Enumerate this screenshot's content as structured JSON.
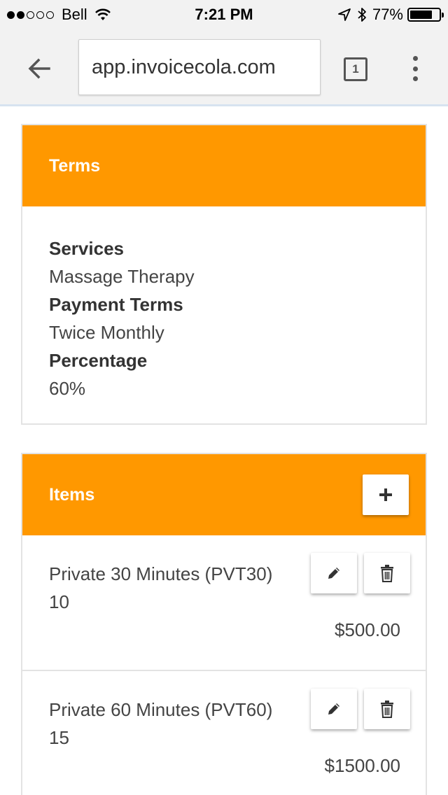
{
  "status_bar": {
    "carrier": "Bell",
    "time": "7:21 PM",
    "battery": "77%",
    "battery_level": 0.77
  },
  "browser": {
    "url": "app.invoicecola.com",
    "tab_count": "1"
  },
  "terms": {
    "title": "Terms",
    "services_label": "Services",
    "services_value": "Massage Therapy",
    "payment_terms_label": "Payment Terms",
    "payment_terms_value": "Twice Monthly",
    "percentage_label": "Percentage",
    "percentage_value": "60%"
  },
  "items": {
    "title": "Items",
    "list": [
      {
        "name": "Private 30 Minutes (PVT30)",
        "quantity": "10",
        "price": "$500.00"
      },
      {
        "name": "Private 60 Minutes (PVT60)",
        "quantity": "15",
        "price": "$1500.00"
      }
    ]
  },
  "colors": {
    "accent": "#ff9800"
  }
}
